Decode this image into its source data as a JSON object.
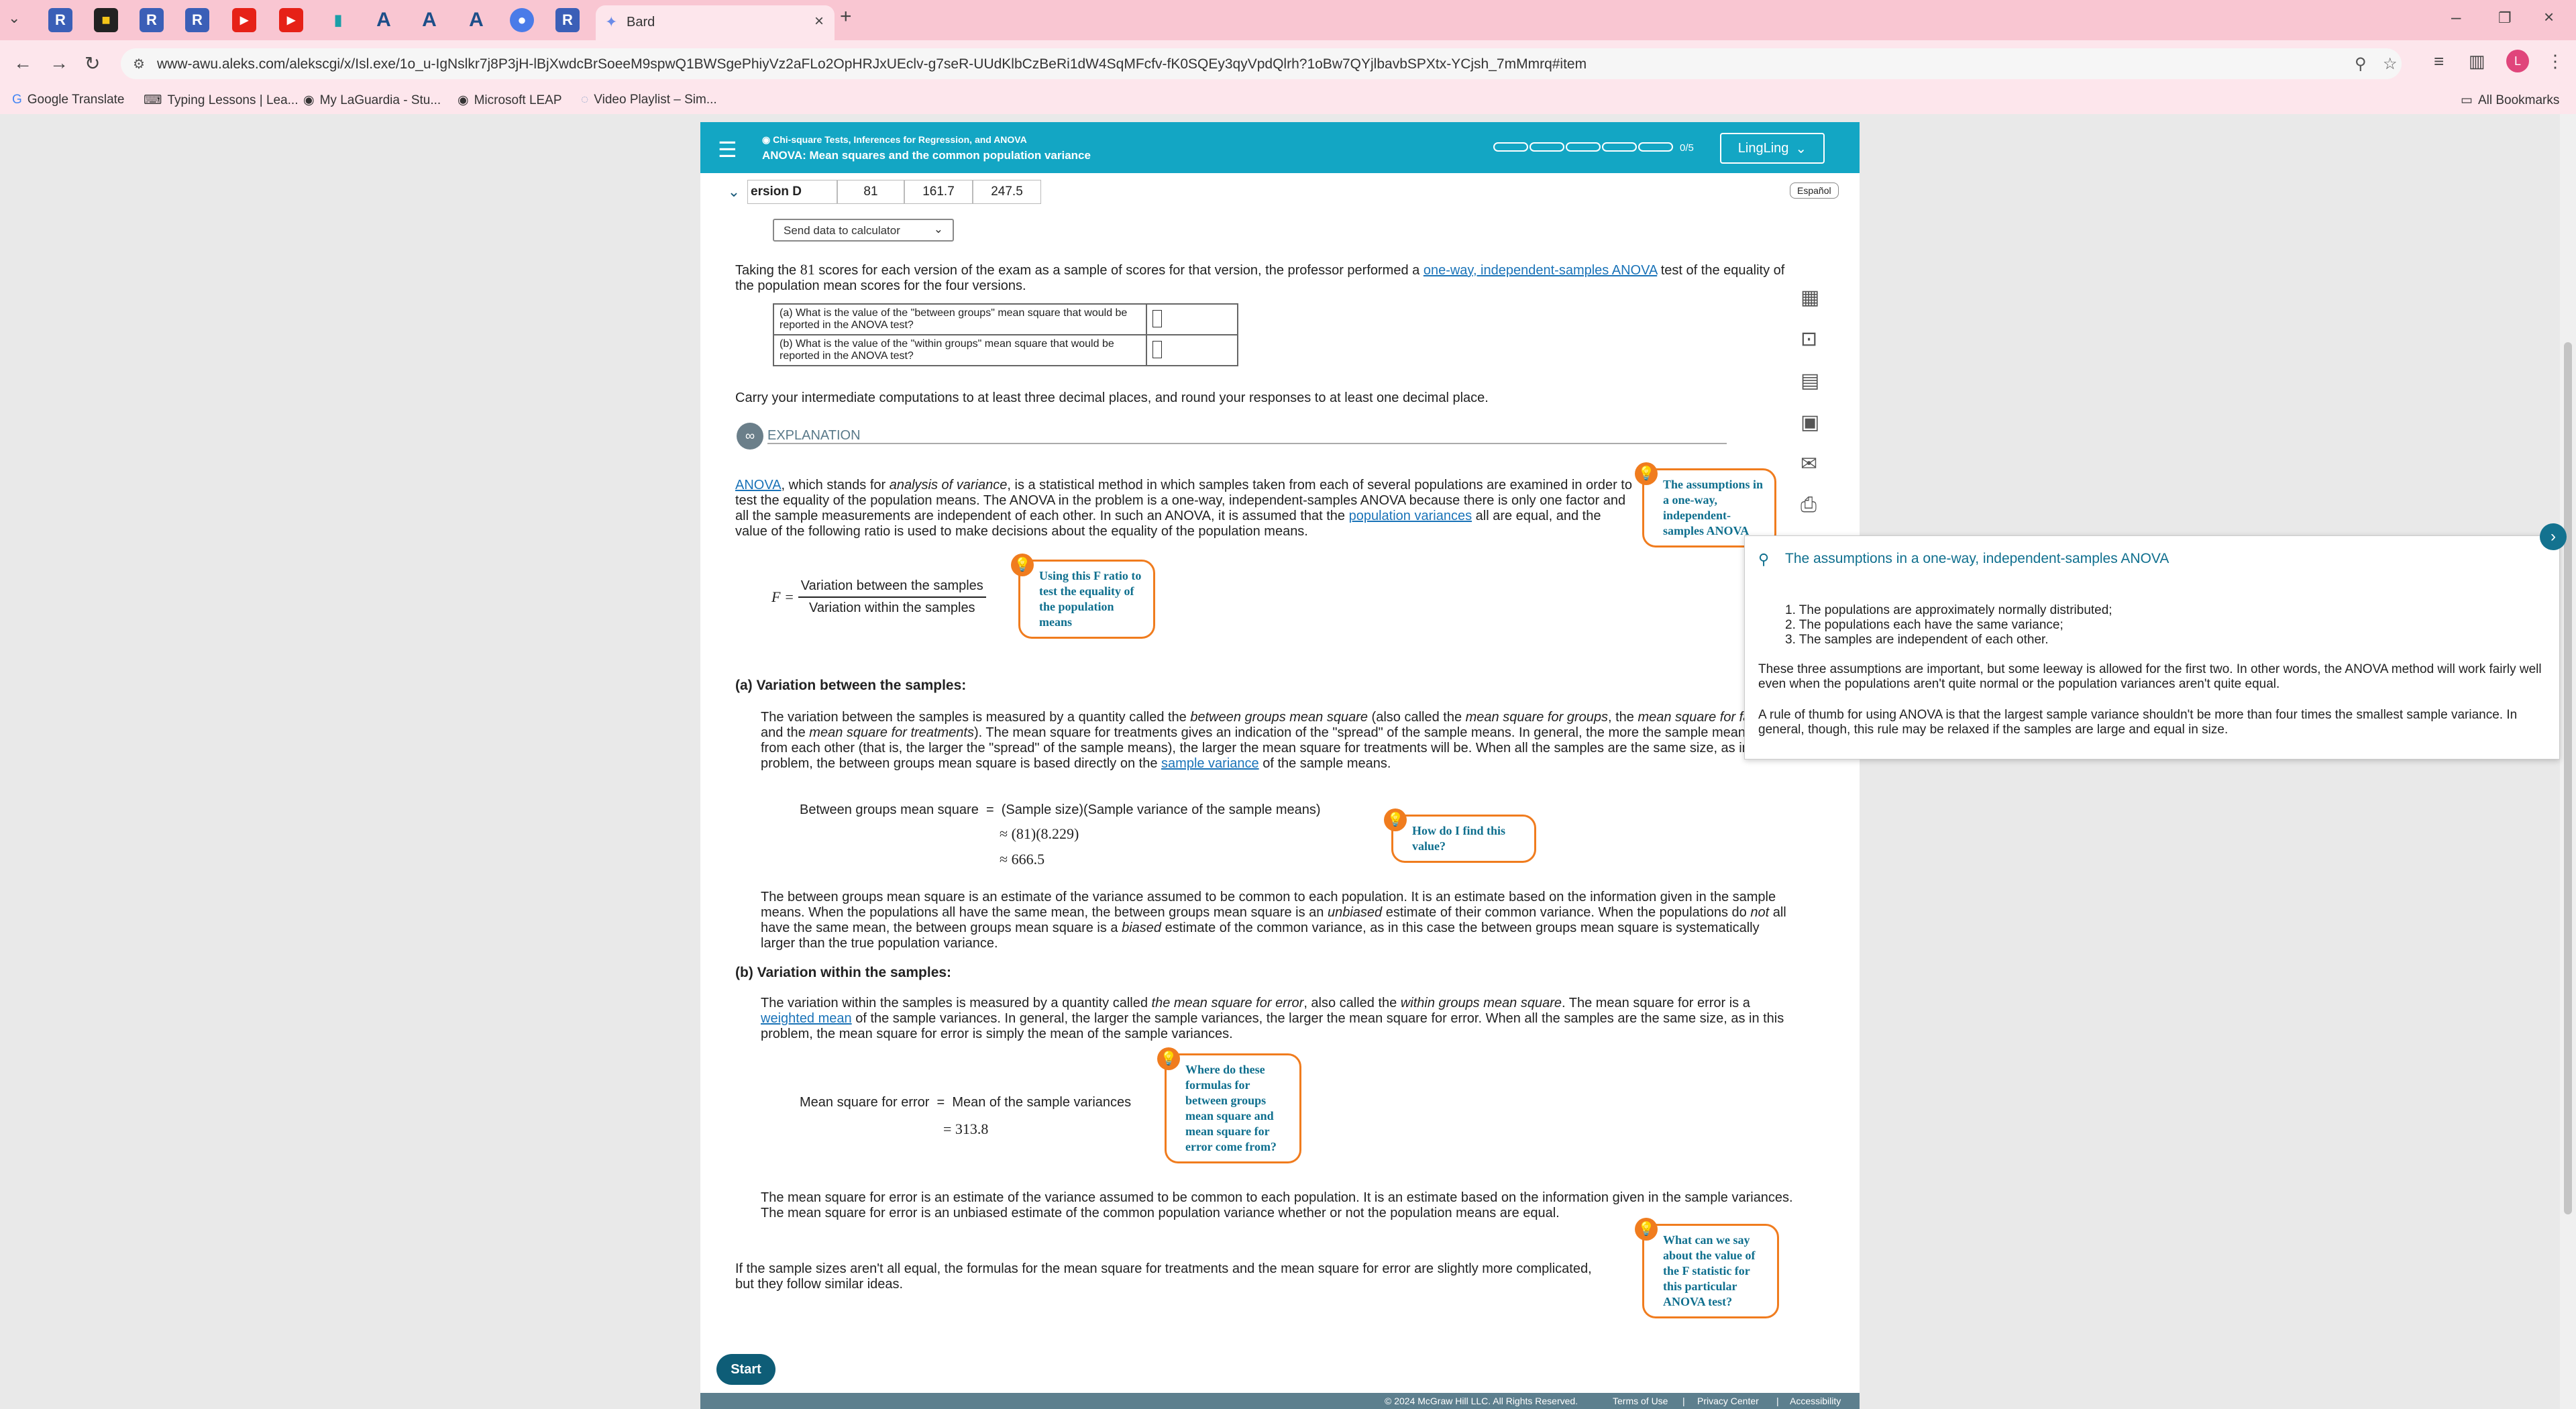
{
  "browser": {
    "active_tab_title": "Bard",
    "url": "www-awu.aleks.com/alekscgi/x/Isl.exe/1o_u-IgNslkr7j8P3jH-lBjXwdcBrSoeeM9spwQ1BWSgePhiyVz2aFLo2OpHRJxUEclv-g7seR-UUdKlbCzBeRi1dW4SqMFcfv-fK0SQEy3qyVpdQlrh?1oBw7QYjlbavbSPXtx-YCjsh_7mMmrq#item",
    "bookmarks": [
      "Google Translate",
      "Typing Lessons | Lea...",
      "My LaGuardia - Stu...",
      "Microsoft LEAP",
      "Video Playlist – Sim..."
    ],
    "all_bookmarks": "All Bookmarks",
    "profile_initial": "L"
  },
  "header": {
    "course_title": "Chi-square Tests, Inferences for Regression, and ANOVA",
    "topic_title": "ANOVA: Mean squares and the common population variance",
    "progress": "0/5",
    "user_name": "LingLing"
  },
  "version_row": {
    "label": "ersion D",
    "n": "81",
    "mean": "161.7",
    "variance": "247.5"
  },
  "espanol": "Español",
  "send_data": "Send data to calculator",
  "problem": {
    "intro_prefix": "Taking the ",
    "intro_n": "81",
    "intro_mid": " scores for each version of the exam as a sample of scores for that version, the professor performed a ",
    "intro_link": "one-way, independent-samples ANOVA",
    "intro_suffix": " test of the equality of the population mean scores for the four versions.",
    "q_a": "(a) What is the value of the \"between groups\" mean square that would be reported in the ANOVA test?",
    "q_b": "(b) What is the value of the \"within groups\" mean square that would be reported in the ANOVA test?",
    "rounding": "Carry your intermediate computations to at least three decimal places, and round your responses to at least one decimal place."
  },
  "explanation": {
    "label": "EXPLANATION",
    "p1_link": "ANOVA",
    "p1_a": ", which stands for ",
    "p1_em": "analysis of variance",
    "p1_b": ", is a statistical method in which samples taken from each of several populations are examined in order to test the equality of the population means. The ANOVA in the problem is a one-way, independent-samples ANOVA because there is only one factor and all the sample measurements are independent of each other. In such an ANOVA, it is assumed that the ",
    "p1_link2": "population variances",
    "p1_c": " all are equal, and the value of the following ratio is used to make decisions about the equality of the population means.",
    "f_label": "F =",
    "f_num": "Variation between the samples",
    "f_den": "Variation within the samples",
    "a_heading": "(a) Variation between the samples:",
    "a_p1_a": "The variation between the samples is measured by a quantity called the ",
    "a_p1_em1": "between groups mean square",
    "a_p1_b": " (also called the ",
    "a_p1_em2": "mean square for groups",
    "a_p1_c": ", the ",
    "a_p1_em3": "mean square for factors",
    "a_p1_d": ", and the ",
    "a_p1_em4": "mean square for treatments",
    "a_p1_e": "). The mean square for treatments gives an indication of the \"spread\" of the sample means. In general, the more the sample means differ from each other (that is, the larger the \"spread\" of the sample means), the larger the mean square for treatments will be. When all the samples are the same size, as in this problem, the between groups mean square is based directly on the ",
    "a_p1_link": "sample variance",
    "a_p1_f": " of the sample means.",
    "bg_label": "Between groups mean square",
    "bg_eq1": "(Sample size)(Sample variance of the sample means)",
    "bg_eq2": "≈ (81)(8.229)",
    "bg_eq3": "≈ 666.5",
    "a_p2_a": "The between groups mean square is an estimate of the variance assumed to be common to each population. It is an estimate based on the information given in the sample means. When the populations all have the same mean, the between groups mean square is an ",
    "a_p2_em1": "unbiased",
    "a_p2_b": " estimate of their common variance. When the populations do ",
    "a_p2_em2": "not",
    "a_p2_c": " all have the same mean, the between groups mean square is a ",
    "a_p2_em3": "biased",
    "a_p2_d": " estimate of the common variance, as in this case the between groups mean square is systematically larger than the true population variance.",
    "b_heading": "(b) Variation within the samples:",
    "b_p1_a": "The variation within the samples is measured by a quantity called ",
    "b_p1_em1": "the mean square for error",
    "b_p1_b": ", also called the ",
    "b_p1_em2": "within groups mean square",
    "b_p1_c": ". The mean square for error is a ",
    "b_p1_link": "weighted mean",
    "b_p1_d": " of the sample variances. In general, the larger the sample variances, the larger the mean square for error. When all the samples are the same size, as in this problem, the mean square for error is simply the mean of the sample variances.",
    "mse_label": "Mean square for error",
    "mse_eq1": "Mean of the sample variances",
    "mse_eq2": "= 313.8",
    "b_p2": "The mean square for error is an estimate of the variance assumed to be common to each population. It is an estimate based on the information given in the sample variances. The mean square for error is an unbiased estimate of the common population variance whether or not the population means are equal.",
    "final": "If the sample sizes aren't all equal, the formulas for the mean square for treatments and the mean square for error are slightly more complicated, but they follow similar ideas."
  },
  "hints": {
    "assumptions": "The assumptions in a one-way, independent-samples ANOVA",
    "f_ratio": "Using this F ratio to test the equality of the population means",
    "find_value": "How do I find this value?",
    "formulas": "Where do these formulas for between groups mean square and mean square for error come from?",
    "f_statistic": "What can we say about the value of the F statistic for this particular ANOVA test?"
  },
  "popup": {
    "title": "The assumptions in a one-way, independent-samples ANOVA",
    "items": [
      "1. The populations are approximately normally distributed;",
      "2. The populations each have the same variance;",
      "3. The samples are independent of each other."
    ],
    "p1": "These three assumptions are important, but some leeway is allowed for the first two. In other words, the ANOVA method will work fairly well even when the populations aren't quite normal or the population variances aren't quite equal.",
    "p2": "A rule of thumb for using ANOVA is that the largest sample variance shouldn't be more than four times the smallest sample variance. In general, though, this rule may be relaxed if the samples are large and equal in size."
  },
  "start_button": "Start",
  "footer": {
    "copyright": "© 2024 McGraw Hill LLC. All Rights Reserved.",
    "terms": "Terms of Use",
    "privacy": "Privacy Center",
    "accessibility": "Accessibility"
  },
  "colors": {
    "header_teal": "#13a6c4",
    "hint_orange": "#f07c1e",
    "link_blue": "#1a73b8",
    "tab_pink": "#f9c6d2"
  }
}
